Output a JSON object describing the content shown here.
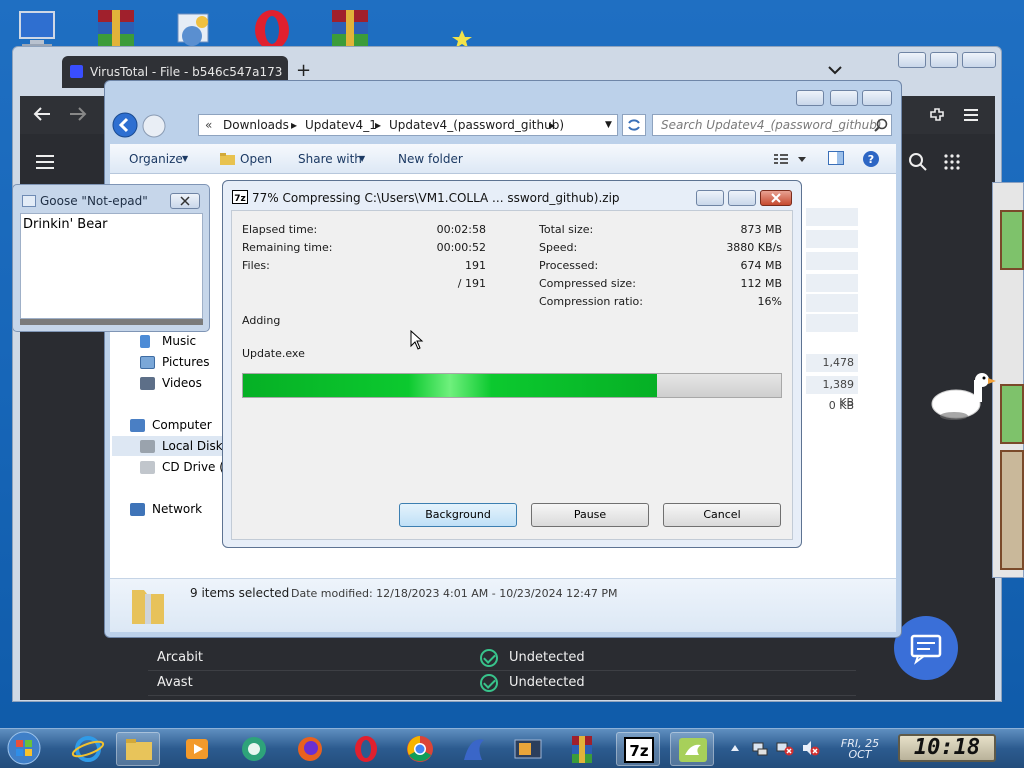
{
  "browser": {
    "tab_title": "VirusTotal - File - b546c547a173",
    "new_tab": "+",
    "results": [
      {
        "engine": "Arcabit",
        "result": "Undetected"
      },
      {
        "engine": "Avast",
        "result": "Undetected"
      }
    ]
  },
  "explorer": {
    "breadcrumb": [
      "Downloads",
      "Updatev4_1",
      "Updatev4_(password_github)"
    ],
    "search_placeholder": "Search Updatev4_(password_github)",
    "commands": {
      "organize": "Organize",
      "open": "Open",
      "share_with": "Share with",
      "new_folder": "New folder"
    },
    "nav": {
      "music": "Music",
      "pictures": "Pictures",
      "videos": "Videos",
      "computer": "Computer",
      "local_disk": "Local Disk (",
      "cd_drive": "CD Drive (D",
      "network": "Network"
    },
    "sizes": [
      "1,478 KB",
      "1,389 KB",
      "0 KB"
    ],
    "status": {
      "selected": "9 items selected",
      "date_modified": "Date modified: 12/18/2023 4:01 AM - 10/23/2024 12:47 PM"
    }
  },
  "goose_notepad": {
    "title": "Goose \"Not-epad\"",
    "text": "Drinkin' Bear"
  },
  "zip_dialog": {
    "title": "77% Compressing C:\\Users\\VM1.COLLA ... ssword_github).zip",
    "labels": {
      "elapsed": "Elapsed time:",
      "remaining": "Remaining time:",
      "files": "Files:",
      "total_size": "Total size:",
      "speed": "Speed:",
      "processed": "Processed:",
      "compressed_size": "Compressed size:",
      "compression_ratio": "Compression ratio:"
    },
    "values": {
      "elapsed": "00:02:58",
      "remaining": "00:00:52",
      "files": "191",
      "files_total": "/ 191",
      "total_size": "873 MB",
      "speed": "3880 KB/s",
      "processed": "674 MB",
      "compressed_size": "112 MB",
      "compression_ratio": "16%"
    },
    "operation": "Adding",
    "current_file": "Update.exe",
    "progress_percent": 77,
    "buttons": {
      "background": "Background",
      "pause": "Pause",
      "cancel": "Cancel"
    }
  },
  "taskbar": {
    "date_day": "FRI, 25",
    "date_month": "OCT",
    "time": "10:18"
  },
  "colors": {
    "progress_green": "#06b025",
    "vt_check": "#38c38b",
    "chat_button": "#3a6fd8"
  }
}
